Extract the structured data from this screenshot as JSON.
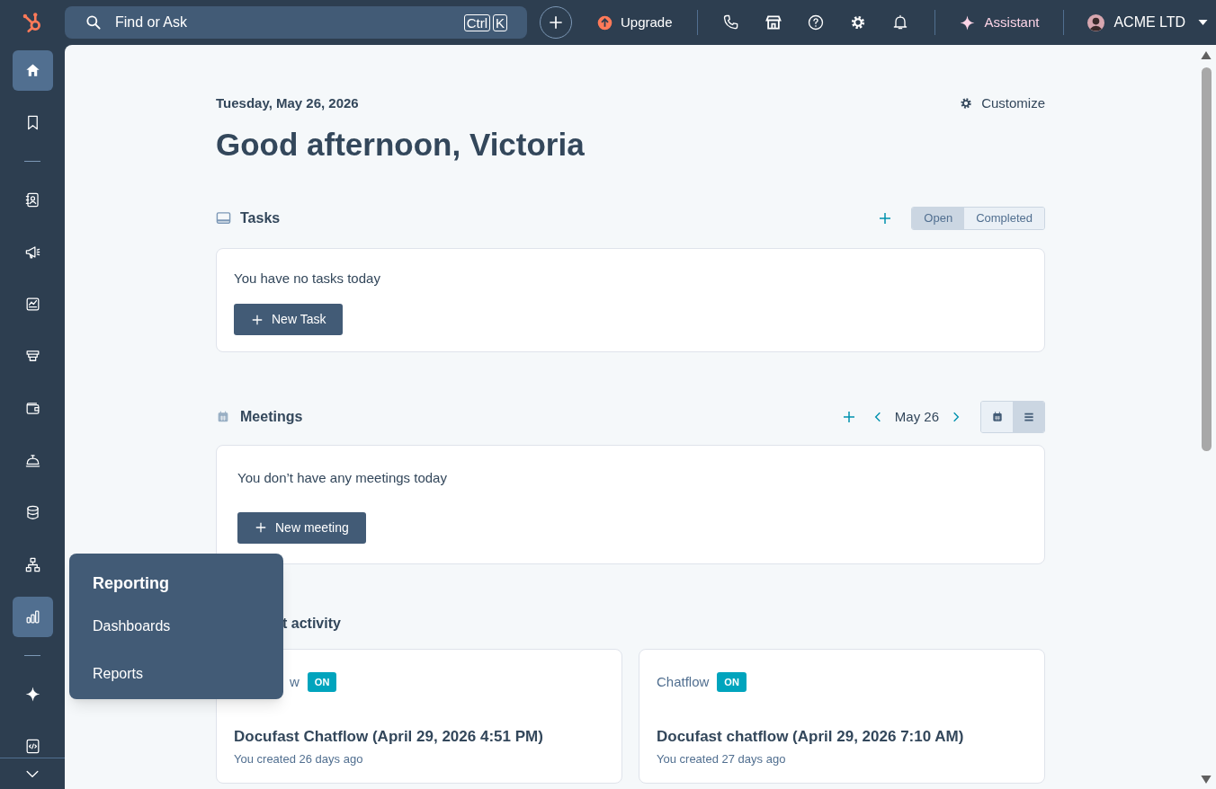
{
  "topbar": {
    "search": {
      "placeholder": "Find or Ask",
      "shortcut": [
        "Ctrl",
        "K"
      ]
    },
    "upgrade": "Upgrade",
    "assistant": "Assistant",
    "account": "ACME LTD"
  },
  "sidebar": {
    "groups": [
      [
        {
          "kind": "home",
          "selected": true
        },
        {
          "kind": "bookmark",
          "selected": false
        }
      ],
      [
        {
          "kind": "contacts",
          "selected": false
        },
        {
          "kind": "megaphone",
          "selected": false
        },
        {
          "kind": "report",
          "selected": false
        },
        {
          "kind": "funnel",
          "selected": false
        },
        {
          "kind": "wallet",
          "selected": false
        },
        {
          "kind": "service-bell",
          "selected": false
        },
        {
          "kind": "database",
          "selected": false
        },
        {
          "kind": "hierarchy",
          "selected": false
        },
        {
          "kind": "bar-chart",
          "selected": true
        }
      ],
      [
        {
          "kind": "sparkle",
          "selected": false
        },
        {
          "kind": "code",
          "selected": false
        }
      ]
    ]
  },
  "header": {
    "date": "Tuesday, May 26, 2026",
    "greeting": "Good afternoon, Victoria",
    "customize": "Customize"
  },
  "tasks": {
    "title": "Tasks",
    "tabs": [
      {
        "label": "Open",
        "selected": true
      },
      {
        "label": "Completed",
        "selected": false
      }
    ],
    "empty_text": "You have no tasks today",
    "button": "New Task"
  },
  "meetings": {
    "title": "Meetings",
    "date": "May 26",
    "views": [
      {
        "kind": "calendar",
        "selected": false
      },
      {
        "kind": "list",
        "selected": true
      }
    ],
    "empty_text": "You don’t have any meetings today",
    "button": "New meeting"
  },
  "recent_activity": {
    "title": "t activity",
    "cards": [
      {
        "type": "w",
        "status": "ON",
        "title": "Docufast Chatflow (April 29, 2026 4:51 PM)",
        "subtitle": "You created 26 days ago"
      },
      {
        "type": "Chatflow",
        "status": "ON",
        "title": "Docufast chatflow (April 29, 2026 7:10 AM)",
        "subtitle": "You created 27 days ago"
      }
    ]
  },
  "flyout": {
    "title": "Reporting",
    "items": [
      "Dashboards",
      "Reports"
    ]
  }
}
